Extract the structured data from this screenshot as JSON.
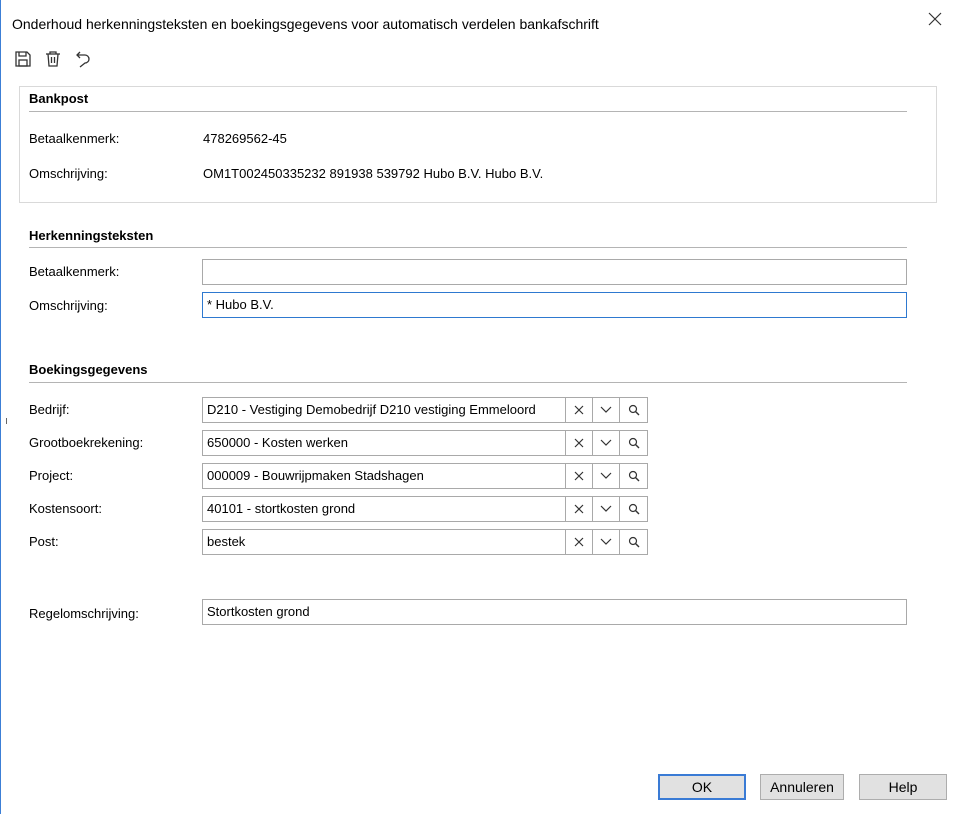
{
  "window": {
    "title": "Onderhoud herkenningsteksten en boekingsgegevens voor automatisch verdelen bankafschrift"
  },
  "toolbar": {
    "icons": [
      "save-icon",
      "trash-icon",
      "undo-icon"
    ]
  },
  "bankpost": {
    "title": "Bankpost",
    "betaalkenmerk_label": "Betaalkenmerk:",
    "betaalkenmerk_value": "478269562-45",
    "omschrijving_label": "Omschrijving:",
    "omschrijving_value": "OM1T002450335232 891938 539792 Hubo B.V. Hubo B.V."
  },
  "herkenning": {
    "title": "Herkenningsteksten",
    "betaalkenmerk_label": "Betaalkenmerk:",
    "betaalkenmerk_value": "",
    "omschrijving_label": "Omschrijving:",
    "omschrijving_value": "* Hubo B.V."
  },
  "boeking": {
    "title": "Boekingsgegevens",
    "fields": [
      {
        "label": "Bedrijf:",
        "value": "D210 - Vestiging Demobedrijf D210 vestiging Emmeloord"
      },
      {
        "label": "Grootboekrekening:",
        "value": "650000 - Kosten werken"
      },
      {
        "label": "Project:",
        "value": "000009 - Bouwrijpmaken Stadshagen"
      },
      {
        "label": "Kostensoort:",
        "value": "40101 - stortkosten grond"
      },
      {
        "label": "Post:",
        "value": "bestek"
      }
    ],
    "regel_label": "Regelomschrijving:",
    "regel_value": "Stortkosten grond"
  },
  "buttons": {
    "ok": "OK",
    "annuleren": "Annuleren",
    "help": "Help"
  },
  "colors": {
    "accent": "#2e79d0",
    "border": "#a9a9a9",
    "button_bg": "#e1e1e1"
  }
}
